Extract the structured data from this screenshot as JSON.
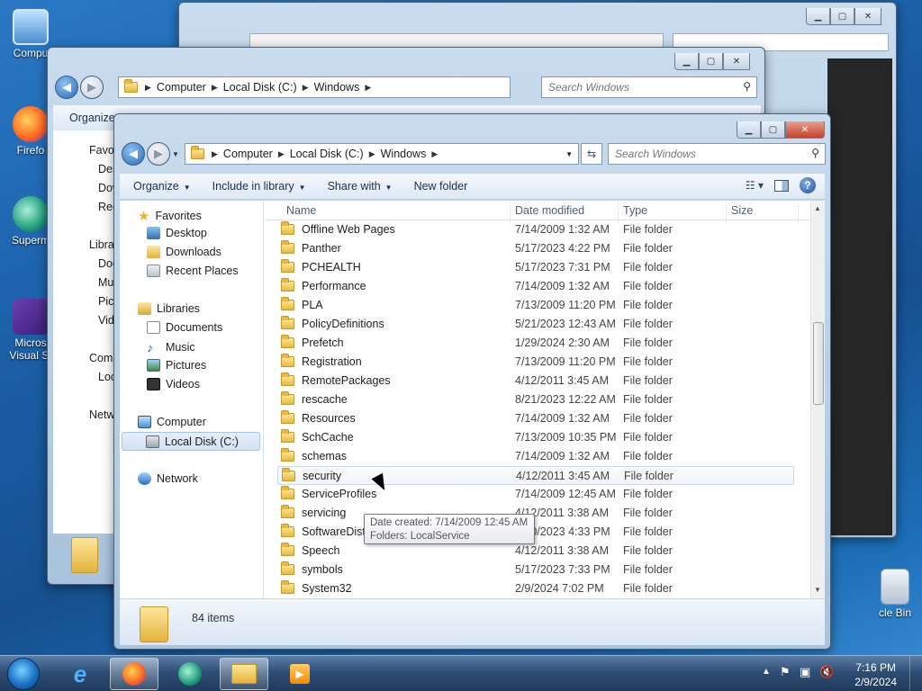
{
  "desktop": {
    "icons": [
      {
        "label": "Compu",
        "icon": "computer-icon"
      },
      {
        "label": "Firefo",
        "icon": "firefox-icon"
      },
      {
        "label": "Superm",
        "icon": "supermium-icon"
      },
      {
        "label": "Micros Visual St",
        "icon": "visual-studio-icon"
      },
      {
        "label": "cle Bin",
        "icon": "recycle-bin-icon"
      }
    ]
  },
  "back_window": {
    "address": [
      "Computer",
      "Local Disk (C:)",
      "Windows"
    ],
    "search_placeholder": "Search Windows",
    "organize": "Organize",
    "nav": [
      "Favo",
      "Des",
      "Dow",
      "Rec",
      "Libra",
      "Doc",
      "Mu",
      "Pic",
      "Vid",
      "Com",
      "Loc",
      "Netw"
    ]
  },
  "window": {
    "address": [
      "Computer",
      "Local Disk (C:)",
      "Windows"
    ],
    "search_placeholder": "Search Windows",
    "toolbar": {
      "organize": "Organize",
      "include_in_library": "Include in library",
      "share_with": "Share with",
      "new_folder": "New folder"
    },
    "nav": {
      "favorites": "Favorites",
      "desktop": "Desktop",
      "downloads": "Downloads",
      "recent_places": "Recent Places",
      "libraries": "Libraries",
      "documents": "Documents",
      "music": "Music",
      "pictures": "Pictures",
      "videos": "Videos",
      "computer": "Computer",
      "local_disk": "Local Disk (C:)",
      "network": "Network"
    },
    "columns": {
      "name": "Name",
      "date": "Date modified",
      "type": "Type",
      "size": "Size"
    },
    "files": [
      {
        "name": "Offline Web Pages",
        "date": "7/14/2009 1:32 AM",
        "type": "File folder"
      },
      {
        "name": "Panther",
        "date": "5/17/2023 4:22 PM",
        "type": "File folder"
      },
      {
        "name": "PCHEALTH",
        "date": "5/17/2023 7:31 PM",
        "type": "File folder"
      },
      {
        "name": "Performance",
        "date": "7/14/2009 1:32 AM",
        "type": "File folder"
      },
      {
        "name": "PLA",
        "date": "7/13/2009 11:20 PM",
        "type": "File folder"
      },
      {
        "name": "PolicyDefinitions",
        "date": "5/21/2023 12:43 AM",
        "type": "File folder"
      },
      {
        "name": "Prefetch",
        "date": "1/29/2024 2:30 AM",
        "type": "File folder"
      },
      {
        "name": "Registration",
        "date": "7/13/2009 11:20 PM",
        "type": "File folder"
      },
      {
        "name": "RemotePackages",
        "date": "4/12/2011 3:45 AM",
        "type": "File folder"
      },
      {
        "name": "rescache",
        "date": "8/21/2023 12:22 AM",
        "type": "File folder"
      },
      {
        "name": "Resources",
        "date": "7/14/2009 1:32 AM",
        "type": "File folder"
      },
      {
        "name": "SchCache",
        "date": "7/13/2009 10:35 PM",
        "type": "File folder"
      },
      {
        "name": "schemas",
        "date": "7/14/2009 1:32 AM",
        "type": "File folder"
      },
      {
        "name": "security",
        "date": "4/12/2011 3:45 AM",
        "type": "File folder"
      },
      {
        "name": "ServiceProfiles",
        "date": "7/14/2009 12:45 AM",
        "type": "File folder"
      },
      {
        "name": "servicing",
        "date": "4/12/2011 3:38 AM",
        "type": "File folder"
      },
      {
        "name": "SoftwareDistribution",
        "date": "5/20/2023 4:33 PM",
        "type": "File folder"
      },
      {
        "name": "Speech",
        "date": "4/12/2011 3:38 AM",
        "type": "File folder"
      },
      {
        "name": "symbols",
        "date": "5/17/2023 7:33 PM",
        "type": "File folder"
      },
      {
        "name": "System32",
        "date": "2/9/2024 7:02 PM",
        "type": "File folder"
      }
    ],
    "tooltip": {
      "line1": "Date created: 7/14/2009 12:45 AM",
      "line2": "Folders: LocalService"
    },
    "status": "84 items"
  },
  "taskbar": {
    "time": "7:16 PM",
    "date": "2/9/2024"
  },
  "colors": {
    "selection": "#cce4f7",
    "accent": "#2a6ab4"
  }
}
